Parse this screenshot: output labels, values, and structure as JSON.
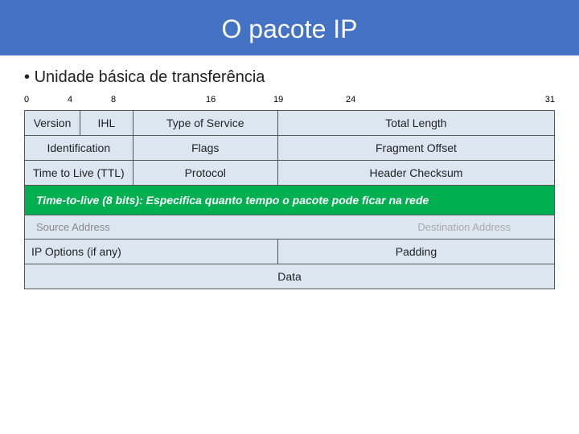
{
  "header": {
    "title": "O pacote IP"
  },
  "subtitle": {
    "bullet": "•",
    "text": "Unidade básica de transferência"
  },
  "bit_labels": {
    "values": [
      "0",
      "4",
      "8",
      "16",
      "19",
      "24",
      "31"
    ]
  },
  "table": {
    "rows": [
      {
        "cells": [
          {
            "text": "Version",
            "colspan": 1,
            "width": "8%"
          },
          {
            "text": "IHL",
            "colspan": 1,
            "width": "8%"
          },
          {
            "text": "Type of Service",
            "colspan": 1,
            "width": "22%"
          },
          {
            "text": "Total Length",
            "colspan": 1,
            "width": "42%"
          }
        ]
      },
      {
        "cells": [
          {
            "text": "Identification",
            "colspan": 1,
            "width": "55%"
          },
          {
            "text": "Flags",
            "colspan": 1,
            "width": "13%"
          },
          {
            "text": "Fragment Offset",
            "colspan": 1,
            "width": "32%"
          }
        ]
      },
      {
        "cells": [
          {
            "text": "Time to Live (TTL)",
            "colspan": 1,
            "width": "30%"
          },
          {
            "text": "Protocol",
            "colspan": 1,
            "width": "25%"
          },
          {
            "text": "Header Checksum",
            "colspan": 1,
            "width": "45%"
          }
        ]
      },
      {
        "tooltip": true,
        "text": "Time-to-live (8 bits): Especifica quanto tempo o pacote pode ficar na rede"
      },
      {
        "source_dest": true,
        "cells": [
          {
            "text": "Source Address",
            "width": "50%"
          },
          {
            "text": "",
            "width": "50%",
            "overlay": true
          }
        ]
      },
      {
        "cells": [
          {
            "text": "IP Options (if any)",
            "colspan": 1,
            "width": "62%"
          },
          {
            "text": "Padding",
            "colspan": 1,
            "width": "38%"
          }
        ]
      },
      {
        "cells": [
          {
            "text": "Data",
            "colspan": 3,
            "width": "100%"
          }
        ]
      }
    ]
  }
}
